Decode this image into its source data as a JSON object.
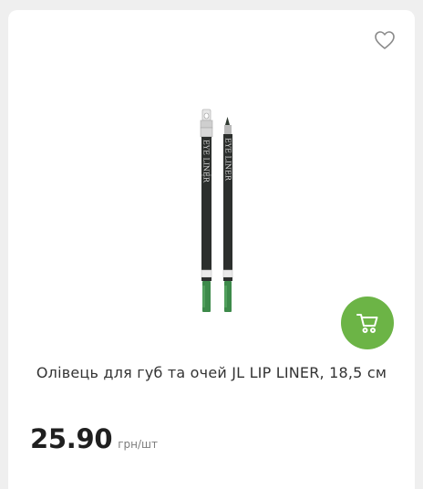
{
  "product": {
    "title": "Олівець для губ та очей JL LIP LINER, 18,5 см",
    "price": "25.90",
    "unit": "грн/шт",
    "pencil_text": "EYE LINER",
    "icons": {
      "favorite": "heart-outline-icon",
      "cart": "shopping-cart-icon"
    },
    "colors": {
      "cart_button": "#6cb446",
      "pencil_body": "#2c2f2d",
      "pencil_tip": "#3d8a4a"
    }
  }
}
